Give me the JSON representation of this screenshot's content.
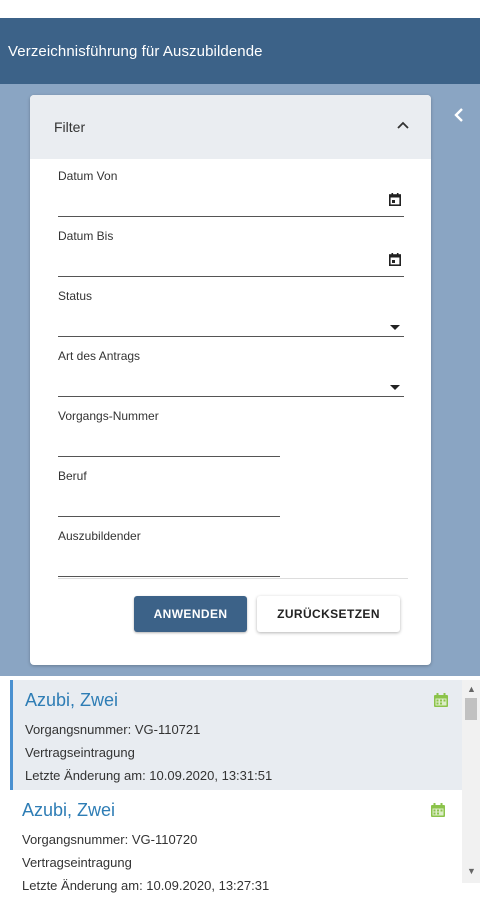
{
  "header": {
    "title": "Verzeichnisführung für Auszubildende"
  },
  "sidebar": {
    "collapse_icon": "chevron-left-icon"
  },
  "filter": {
    "title": "Filter",
    "toggle_icon": "chevron-up-icon",
    "fields": {
      "datum_von": {
        "label": "Datum Von",
        "value": ""
      },
      "datum_bis": {
        "label": "Datum Bis",
        "value": ""
      },
      "status": {
        "label": "Status",
        "value": ""
      },
      "art": {
        "label": "Art des Antrags",
        "value": ""
      },
      "vorgang": {
        "label": "Vorgangs-Nummer",
        "value": ""
      },
      "beruf": {
        "label": "Beruf",
        "value": ""
      },
      "azubi": {
        "label": "Auszubildender",
        "value": ""
      }
    },
    "apply_label": "ANWENDEN",
    "reset_label": "ZURÜCKSETZEN"
  },
  "list": {
    "items": [
      {
        "name": "Azubi, Zwei",
        "vorgang": "Vorgangsnummer: VG-110721",
        "typ": "Vertragseintragung",
        "aenderung": "Letzte Änderung am: 10.09.2020, 13:31:51"
      },
      {
        "name": "Azubi, Zwei",
        "vorgang": "Vorgangsnummer: VG-110720",
        "typ": "Vertragseintragung",
        "aenderung": "Letzte Änderung am: 10.09.2020, 13:27:31"
      }
    ]
  },
  "colors": {
    "header": "#3c6288",
    "panel": "#8aa5c3",
    "accent": "#2e7db5",
    "calendar": "#8bc34a"
  }
}
